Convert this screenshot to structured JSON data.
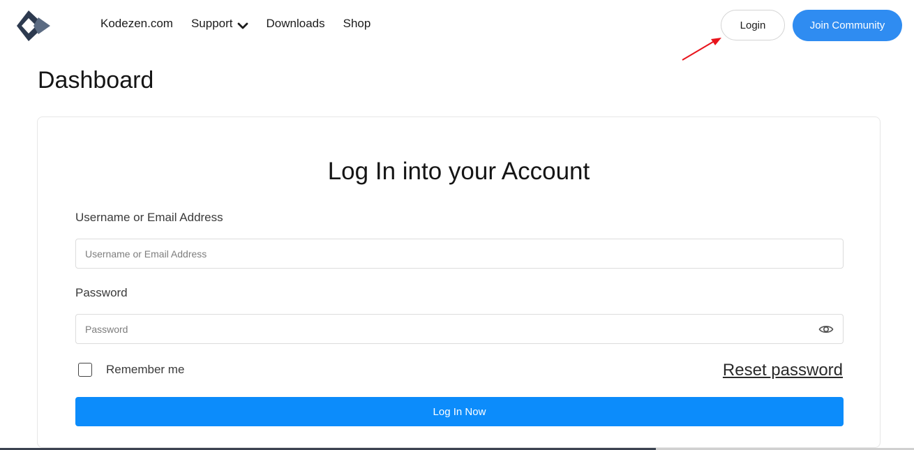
{
  "header": {
    "logo_icon": "kodezen-diamond-logo-icon",
    "nav": [
      {
        "label": "Kodezen.com"
      },
      {
        "label": "Support",
        "icon": "chevron-down-icon"
      },
      {
        "label": "Downloads"
      },
      {
        "label": "Shop"
      }
    ],
    "login_label": "Login",
    "join_label": "Join Community"
  },
  "annotation": {
    "icon": "red-arrow-icon",
    "color": "#e8141c"
  },
  "page": {
    "title": "Dashboard"
  },
  "form": {
    "title": "Log In into your Account",
    "username_label": "Username or Email Address",
    "username_placeholder": "Username or Email Address",
    "username_value": "",
    "password_label": "Password",
    "password_placeholder": "Password",
    "password_value": "",
    "eye_icon": "eye-icon",
    "remember_label": "Remember me",
    "remember_checked": false,
    "reset_label": "Reset password",
    "submit_label": "Log In Now"
  },
  "colors": {
    "accent": "#0c8cfb",
    "join_button": "#2f8cf1",
    "logo_dark": "#2d3a4f",
    "logo_light": "#5b6b82"
  }
}
